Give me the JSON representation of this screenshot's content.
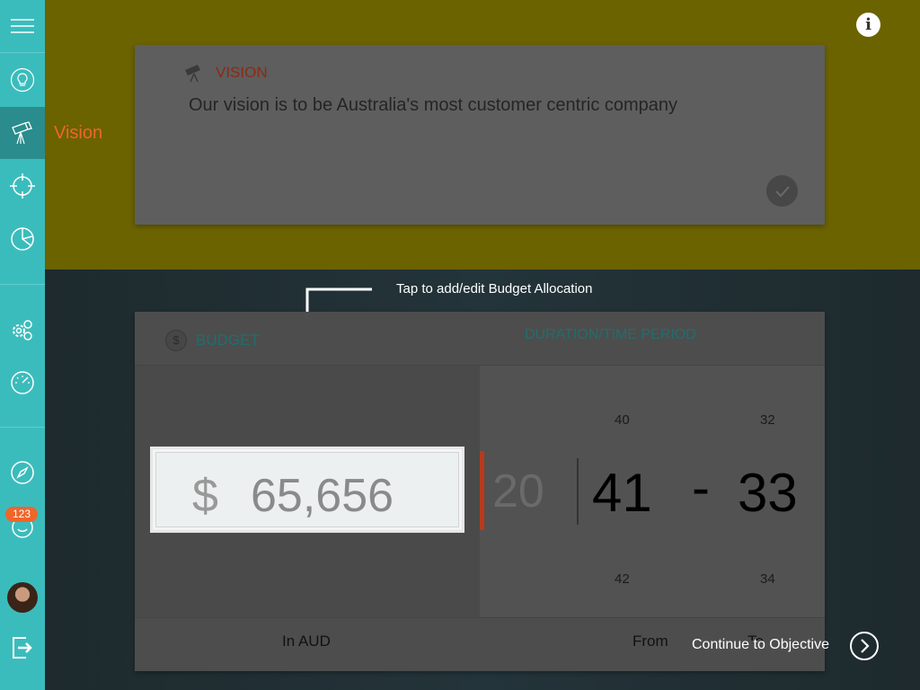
{
  "sidebar": {
    "items": [
      {
        "icon": "menu-icon"
      },
      {
        "icon": "lightbulb-icon"
      },
      {
        "icon": "telescope-icon",
        "active": true
      },
      {
        "icon": "target-icon"
      },
      {
        "icon": "pie-chart-icon"
      },
      {
        "icon": "gears-icon"
      },
      {
        "icon": "speedometer-icon"
      },
      {
        "icon": "compass-icon"
      },
      {
        "icon": "notifications-icon"
      },
      {
        "icon": "avatar"
      },
      {
        "icon": "logout-icon"
      }
    ],
    "badge_count": "123"
  },
  "section_label": "Vision",
  "vision": {
    "title": "VISION",
    "text": "Our vision is to be Australia's most customer centric company"
  },
  "tip": "Tap to add/edit Budget Allocation",
  "budget": {
    "title": "BUDGET",
    "currency_symbol": "$",
    "amount": "65,656",
    "currency_label": "In AUD"
  },
  "duration": {
    "title": "DURATION/TIME PERIOD",
    "left_value": "20",
    "from": {
      "above": "40",
      "selected": "41",
      "below": "42",
      "label": "From"
    },
    "separator": "-",
    "to": {
      "above": "32",
      "selected": "33",
      "below": "34",
      "label": "To"
    }
  },
  "continue_label": "Continue to Objective",
  "colors": {
    "sidebar": "#3bbcbc",
    "sidebar_active": "#2a8c8c",
    "accent": "#f0652a",
    "vision_title": "#8c2a14",
    "section_heading": "#1f6e6e"
  }
}
